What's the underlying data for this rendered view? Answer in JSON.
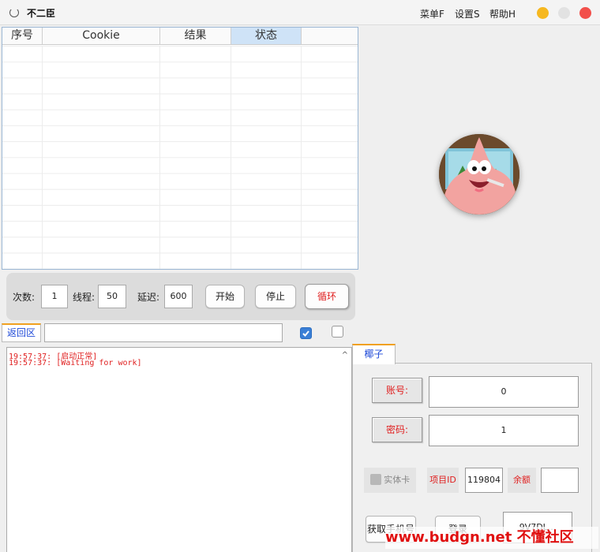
{
  "window": {
    "title": "不二臣",
    "menus": [
      "菜单F",
      "设置S",
      "帮助H"
    ],
    "controls": {
      "minimize_color": "#f6b820",
      "maximize_color": "#e2e2e2",
      "close_color": "#f2504b"
    }
  },
  "table": {
    "columns": [
      "序号",
      "Cookie",
      "结果",
      "状态"
    ],
    "selected_column": "状态",
    "rows": []
  },
  "avatar": {
    "icon": "patrick-star-avatar"
  },
  "controls": {
    "count_label": "次数:",
    "count_value": "1",
    "threads_label": "线程:",
    "threads_value": "50",
    "delay_label": "延迟:",
    "delay_value": "600",
    "start_button": "开始",
    "stop_button": "停止",
    "loop_button": "循环"
  },
  "return_area": {
    "tab_label": "返回区",
    "input_value": "",
    "checkbox1_checked": true,
    "checkbox2_checked": false
  },
  "log": {
    "lines": [
      "19:57:37: [启动正常]",
      "19:57:37: [Waiting for work]"
    ]
  },
  "group": {
    "tab_label": "椰子",
    "account_label": "账号:",
    "account_value": "0",
    "password_label": "密码:",
    "password_value": "1",
    "physical_card_label": "实体卡",
    "physical_card_checked": true,
    "project_id_label": "项目ID",
    "project_id_value": "119804",
    "balance_label": "余额",
    "balance_value": "",
    "get_phone_button": "获取手机号",
    "login_button": "登录",
    "bottom_field_value": "9V7DL..."
  },
  "watermark": "www.budgn.net 不懂社区"
}
